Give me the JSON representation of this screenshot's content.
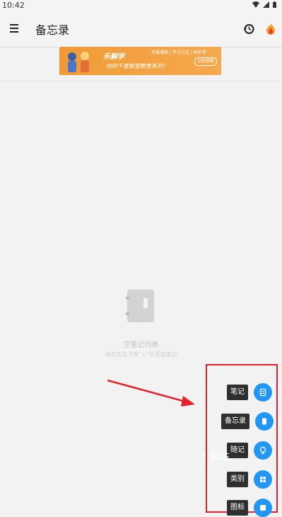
{
  "status": {
    "time": "10:42"
  },
  "appbar": {
    "title": "备忘录"
  },
  "banner": {
    "title": "乐解学",
    "subtitle": "你的千套智慧教育系列！",
    "tags": "专属课程  | 学习方式  | 同步学",
    "button": "立即获取"
  },
  "empty": {
    "title": "空笔记列表",
    "hint": "请点击右下角\"+\"号添加笔记"
  },
  "fab_menu": [
    "笔记",
    "备忘录",
    "随记",
    "类别",
    "图标"
  ],
  "watermark": "3 载站",
  "colors": {
    "accent": "#2196f3",
    "highlight": "#e5212a",
    "banner": "#f09a36"
  }
}
